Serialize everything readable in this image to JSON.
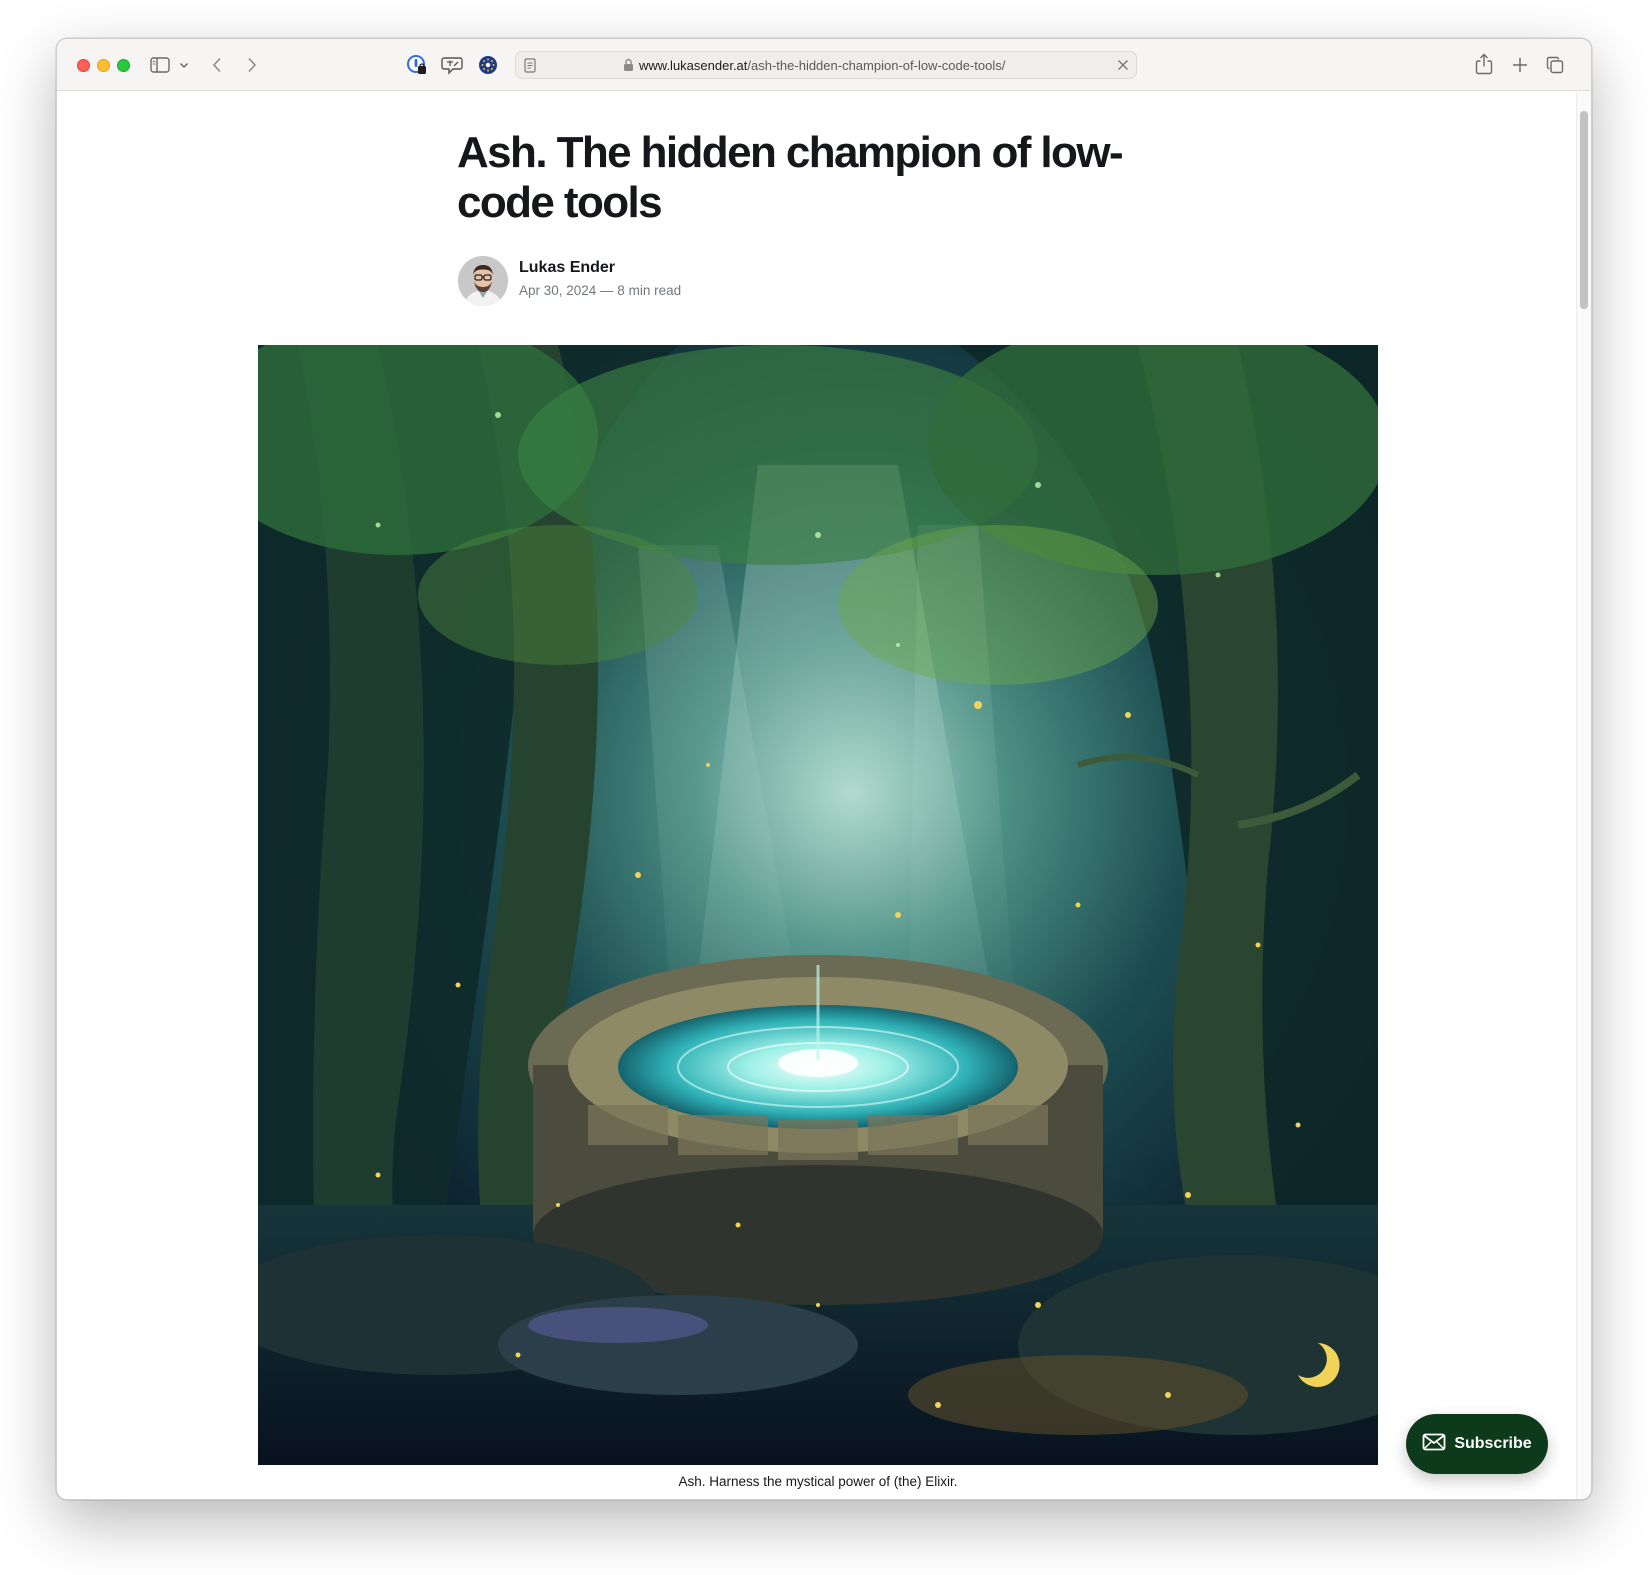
{
  "browser": {
    "url_domain": "www.lukasender.at",
    "url_path": "/ash-the-hidden-champion-of-low-code-tools/",
    "toolbar_icons": [
      "sidebar-icon",
      "chevron-down-icon",
      "back-icon",
      "forward-icon",
      "password-extension-icon",
      "translate-extension-icon",
      "eu-extension-icon",
      "reader-icon",
      "lock-icon",
      "clear-icon",
      "share-icon",
      "new-tab-icon",
      "tab-overview-icon"
    ]
  },
  "article": {
    "title": "Ash. The hidden champion of low-code tools",
    "author": "Lukas Ender",
    "meta": "Apr 30, 2024 — 8 min read",
    "image_caption": "Ash. Harness the mystical power of (the) Elixir."
  },
  "subscribe": {
    "label": "Subscribe"
  },
  "colors": {
    "subscribe_bg": "#0d3a1a",
    "title_text": "#15171a",
    "meta_text": "#73787c"
  }
}
